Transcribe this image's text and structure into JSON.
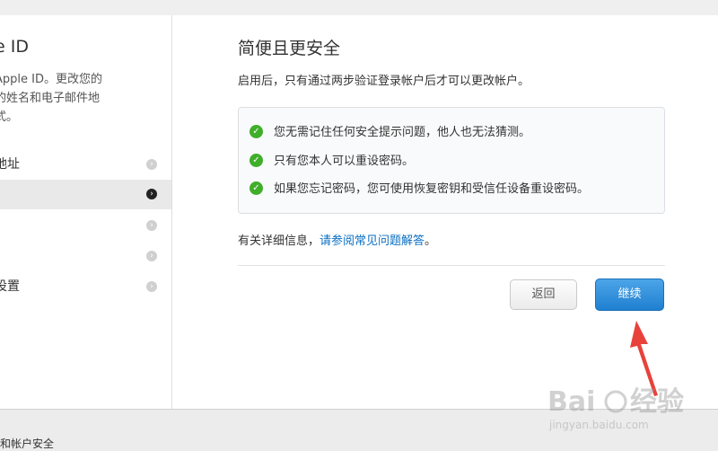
{
  "sidebar": {
    "title": "e ID",
    "description": "Apple ID。更改您的\n的姓名和电子邮件地\n式。",
    "items": [
      {
        "label": "地址",
        "active": false
      },
      {
        "label": "",
        "active": true
      },
      {
        "label": "",
        "active": false
      },
      {
        "label": "",
        "active": false
      },
      {
        "label": "设置",
        "active": false
      }
    ]
  },
  "main": {
    "title": "简便且更安全",
    "description": "启用后，只有通过两步验证登录帐户后才可以更改帐户。",
    "features": [
      "您无需记住任何安全提示问题，他人也无法猜测。",
      "只有您本人可以重设密码。",
      "如果您忘记密码，您可使用恢复密钥和受信任设备重设密码。"
    ],
    "more_prefix": "有关详细信息，",
    "more_link": "请参阅常见问题解答",
    "more_suffix": "。",
    "back_label": "返回",
    "continue_label": "继续"
  },
  "footer": {
    "text": "和帐户安全"
  },
  "watermark": {
    "logo": "Baidu经验",
    "url": "jingyan.baidu.com"
  },
  "colors": {
    "accent": "#1f7fd0",
    "check": "#3fae2a",
    "link": "#0a6fc2",
    "arrow": "#e8423b"
  }
}
